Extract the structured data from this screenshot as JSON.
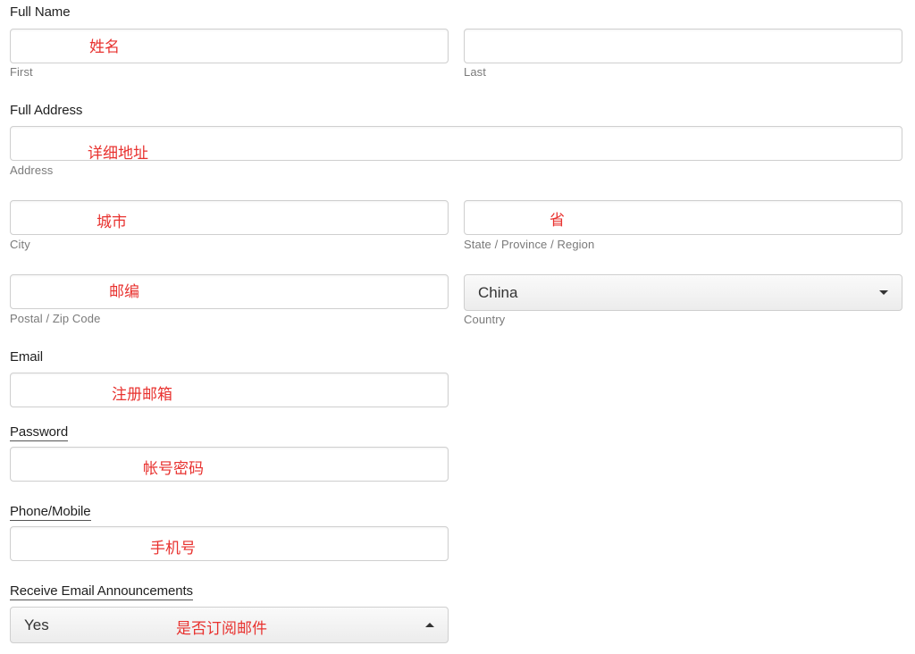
{
  "full_name": {
    "label": "Full Name",
    "first": {
      "sublabel": "First",
      "note": "姓名",
      "value": ""
    },
    "last": {
      "sublabel": "Last",
      "value": ""
    }
  },
  "full_address": {
    "label": "Full Address",
    "address": {
      "sublabel": "Address",
      "note": "详细地址",
      "value": ""
    },
    "city": {
      "sublabel": "City",
      "note": "城市",
      "value": ""
    },
    "state": {
      "sublabel": "State / Province / Region",
      "note": "省",
      "value": ""
    },
    "postal": {
      "sublabel": "Postal / Zip Code",
      "note": "邮编",
      "value": ""
    },
    "country": {
      "sublabel": "Country",
      "selected": "China",
      "icon": "caret-down-icon"
    }
  },
  "email": {
    "label": "Email",
    "note": "注册邮箱",
    "value": ""
  },
  "password": {
    "label": "Password",
    "note": "帐号密码",
    "value": ""
  },
  "phone": {
    "label": "Phone/Mobile",
    "note": "手机号",
    "value": ""
  },
  "announcements": {
    "label": "Receive Email Announcements",
    "selected": "Yes",
    "note": "是否订阅邮件",
    "icon": "caret-up-icon"
  },
  "colors": {
    "annotation": "#e8322f",
    "border": "#cfcfcf",
    "sublabel": "#7a7a7a"
  }
}
